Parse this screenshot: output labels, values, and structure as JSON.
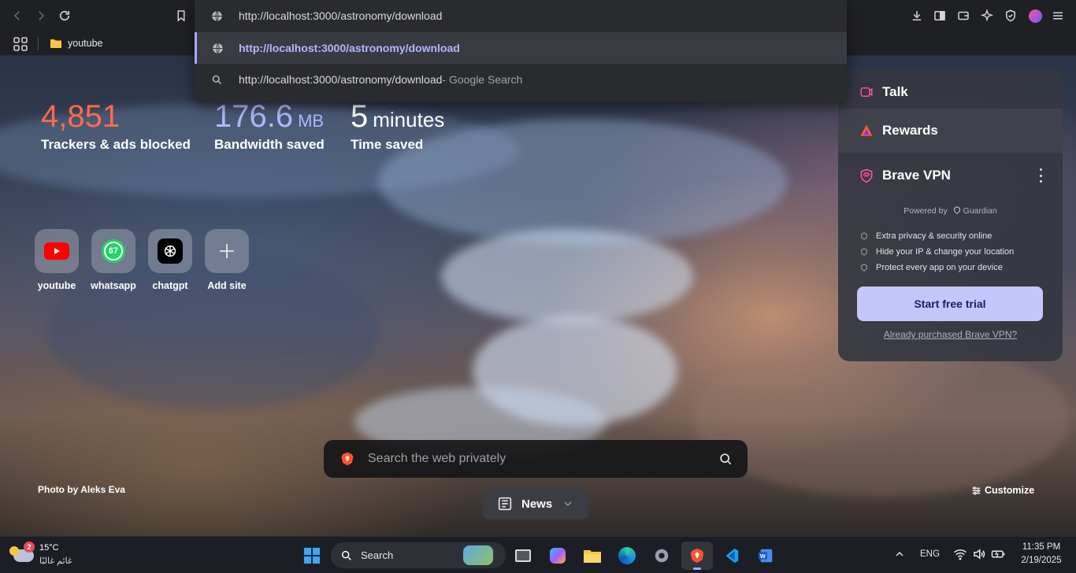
{
  "toolbar": {
    "back_icon": "chevron-left-icon",
    "forward_icon": "chevron-right-icon",
    "reload_icon": "reload-icon",
    "bookmark_icon": "bookmark-icon",
    "right_icons": [
      "download-icon",
      "sidebar-icon",
      "wallet-icon",
      "leo-ai-icon",
      "brave-shields-icon",
      "brave-rewards-profile-icon",
      "menu-icon"
    ]
  },
  "omnibox": {
    "input_value": "http://localhost:3000/astronomy/download",
    "suggestions": [
      {
        "text": "http://localhost:3000/astronomy/download",
        "suffix": "",
        "icon": "globe-icon"
      },
      {
        "text": "http://localhost:3000/astronomy/download",
        "suffix": " - Google Search",
        "icon": "search-icon"
      }
    ]
  },
  "bookmarks": {
    "apps_icon": "apps-grid-icon",
    "items": [
      {
        "label": "youtube",
        "icon": "folder-icon"
      }
    ]
  },
  "stats": {
    "trackers_value": "4,851",
    "trackers_label": "Trackers & ads blocked",
    "bandwidth_value": "176.6",
    "bandwidth_unit": "MB",
    "bandwidth_label": "Bandwidth saved",
    "time_value": "5",
    "time_unit": "minutes",
    "time_label": "Time saved"
  },
  "tiles": [
    {
      "label": "youtube",
      "icon": "youtube-icon"
    },
    {
      "label": "whatsapp",
      "icon": "whatsapp-icon",
      "badge": "67"
    },
    {
      "label": "chatgpt",
      "icon": "chatgpt-icon"
    },
    {
      "label": "Add site",
      "icon": "plus-icon"
    }
  ],
  "panel": {
    "talk": "Talk",
    "rewards": "Rewards",
    "vpn_title": "Brave VPN",
    "powered_by": "Powered by",
    "guardian": "Guardian",
    "features": [
      "Extra privacy & security online",
      "Hide your IP & change your location",
      "Protect every app on your device"
    ],
    "cta": "Start free trial",
    "already": "Already purchased Brave VPN?"
  },
  "photo_credit": "Photo by Aleks Eva",
  "search": {
    "placeholder": "Search the web privately"
  },
  "news": {
    "label": "News"
  },
  "customize": {
    "label": "Customize"
  },
  "taskbar": {
    "weather_temp": "15°C",
    "weather_desc": "غائم غالبًا",
    "weather_badge": "2",
    "search_label": "Search",
    "language": "ENG",
    "time": "11:35 PM",
    "date": "2/19/2025",
    "apps": [
      "task-view-icon",
      "copilot-icon",
      "file-explorer-icon",
      "edge-icon",
      "settings-icon",
      "brave-icon",
      "vscode-icon",
      "word-icon"
    ]
  },
  "colors": {
    "trackers": "#ff6a4d",
    "bandwidth": "#b3b6ff",
    "cta": "#c5c6fb",
    "accent": "#a8a9ff"
  }
}
